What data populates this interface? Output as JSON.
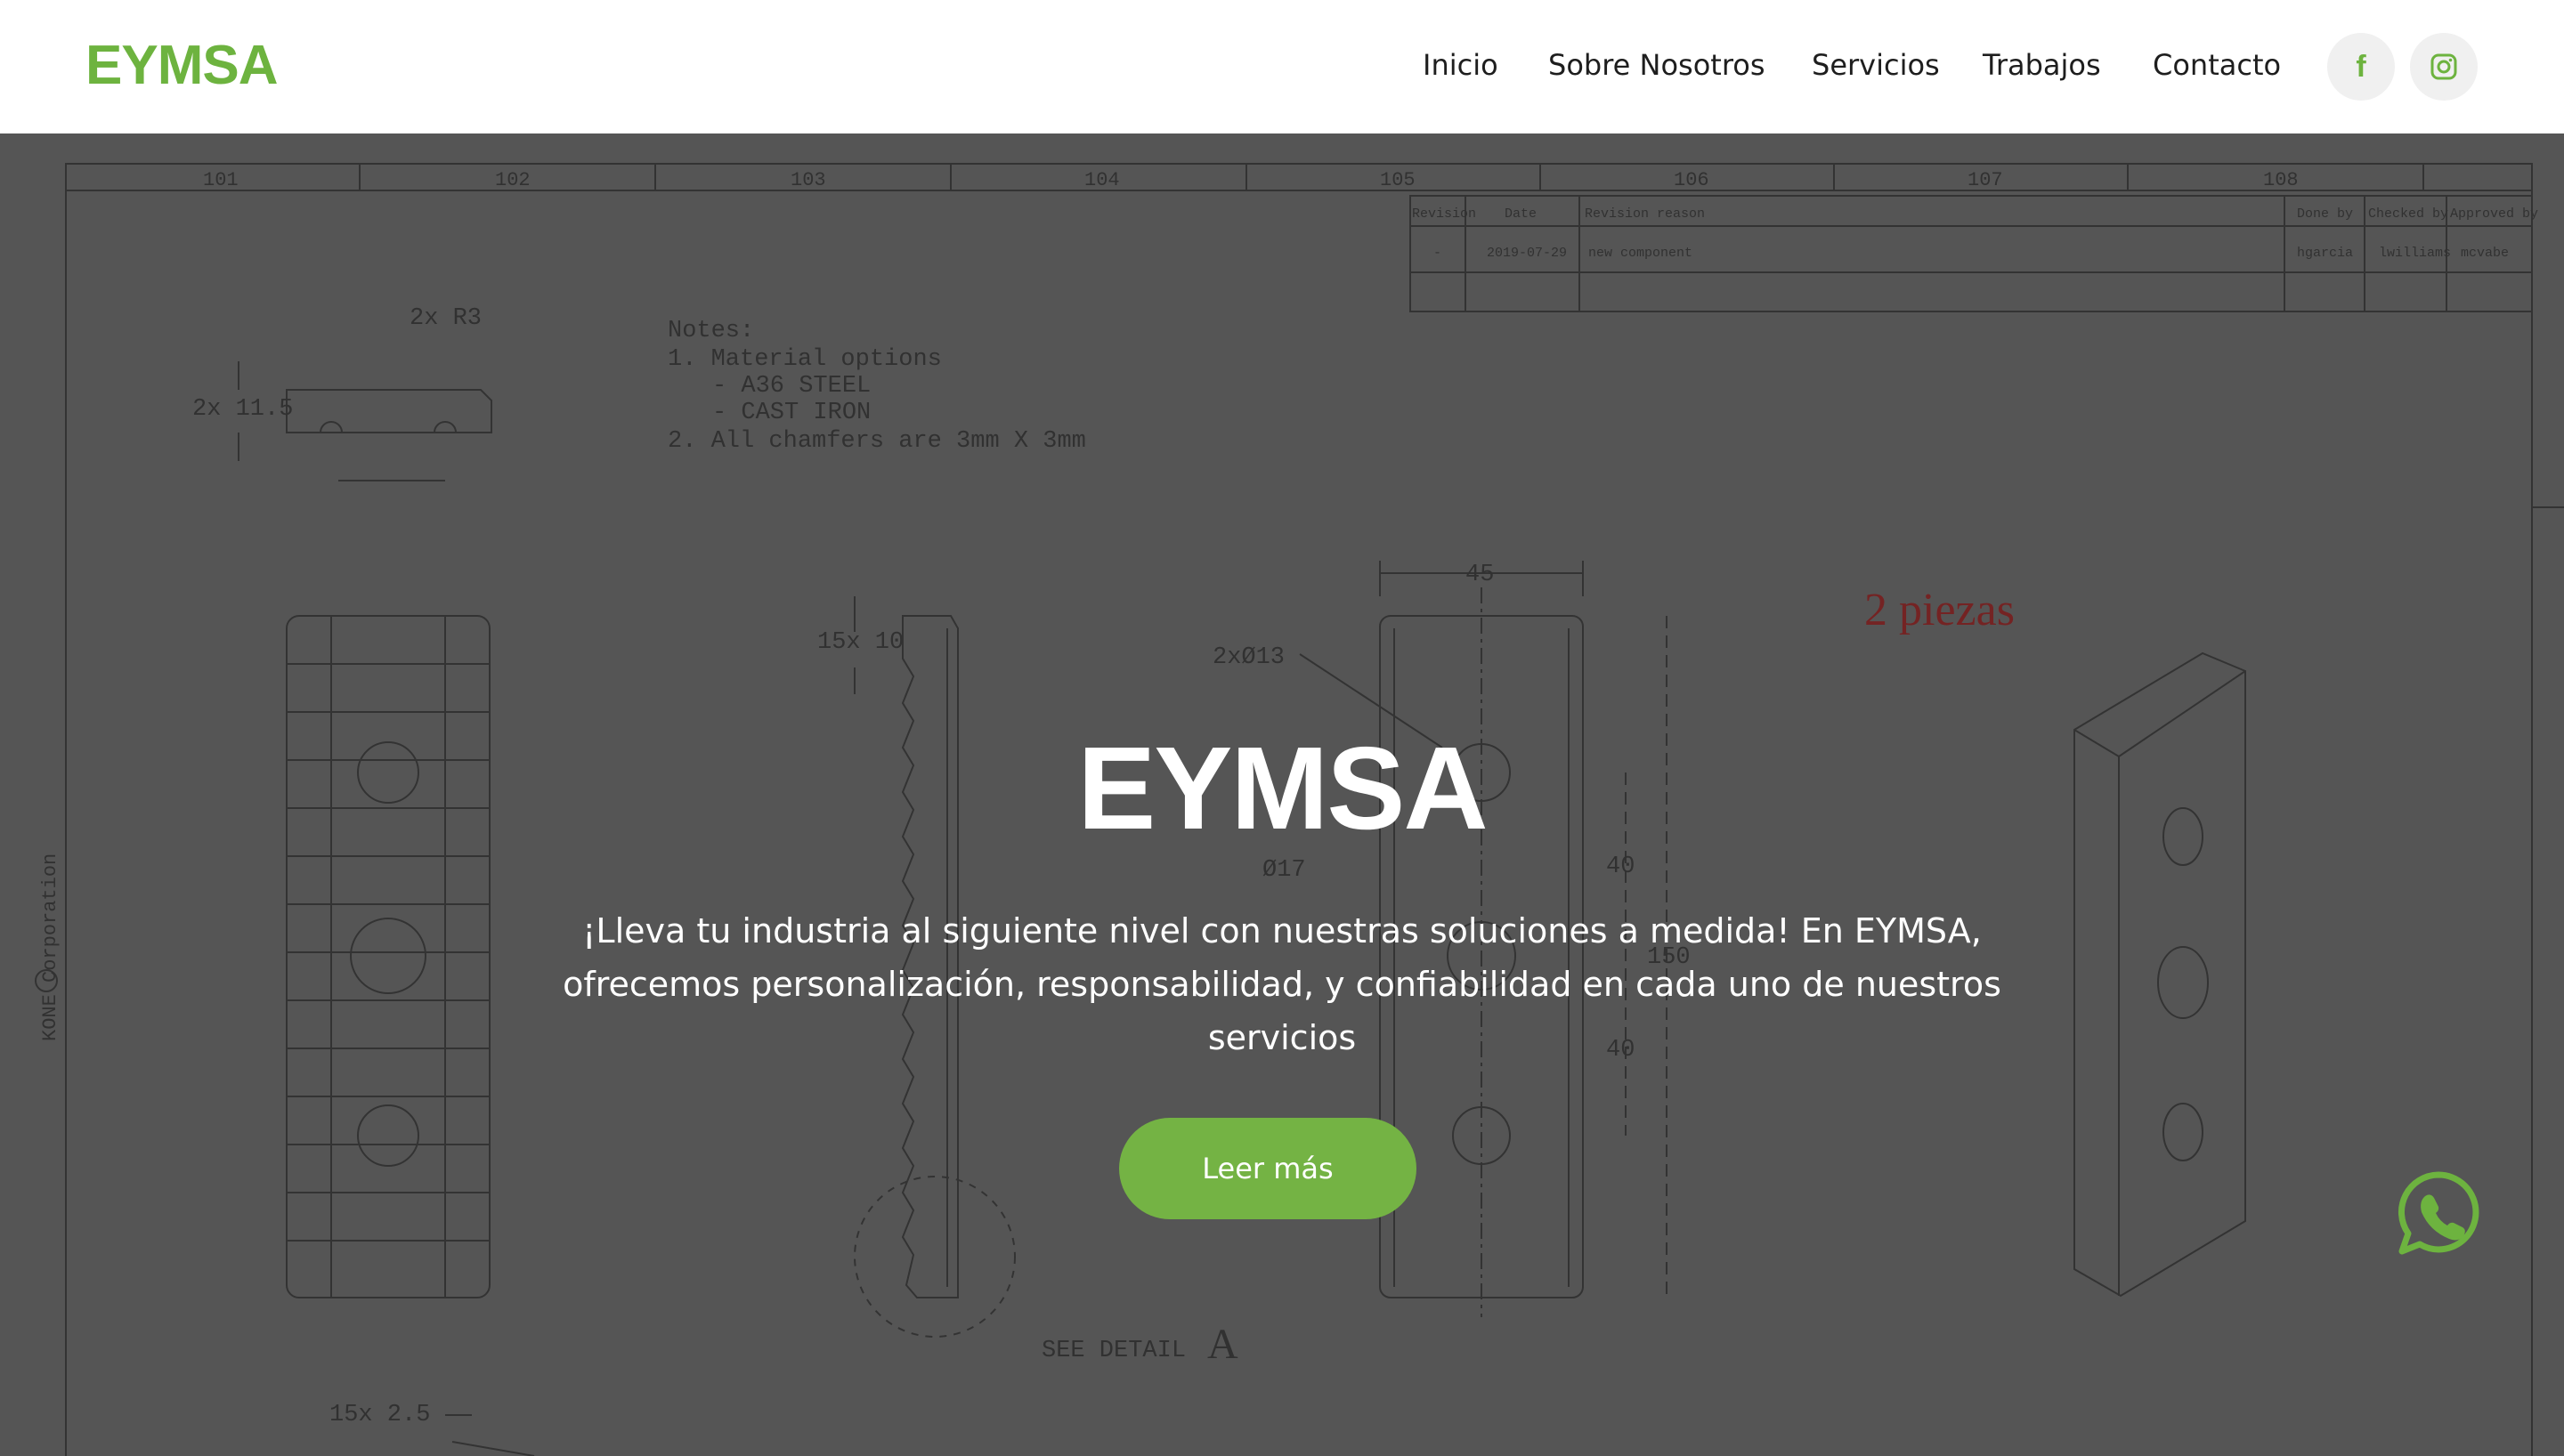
{
  "header": {
    "logo": "EYMSA",
    "nav": [
      "Inicio",
      "Sobre Nosotros",
      "Servicios",
      "Trabajos",
      "Contacto"
    ],
    "social": [
      {
        "icon": "facebook-icon",
        "glyph": "f"
      },
      {
        "icon": "instagram-icon",
        "glyph": ""
      }
    ]
  },
  "hero": {
    "title": "EYMSA",
    "text": "¡Lleva tu industria al siguiente nivel con nuestras soluciones a medida! En EYMSA, ofrecemos personalización, responsabilidad, y confiabilidad en cada uno de nuestros servicios",
    "button": "Leer más",
    "background": {
      "notes": [
        "Notes:",
        "1. Material options",
        "- A36 STEEL",
        "- CAST IRON",
        "2. All chamfers are 3mm X 3mm"
      ],
      "label_pieces": "2 piezas",
      "dims": [
        "2x R3",
        "2x 11.5",
        "15x 10",
        "45",
        "2xØ13",
        "Ø17",
        "40",
        "40",
        "150",
        "15x 2.5",
        "SEE DETAIL",
        "A"
      ],
      "grid_numbers": [
        "101",
        "102",
        "103",
        "104",
        "105",
        "106",
        "107",
        "108"
      ],
      "revision_headers": [
        "Revision",
        "Date",
        "Revision reason",
        "Done by",
        "Checked by",
        "Approved by"
      ],
      "revision_row": [
        "-",
        "2019-07-29",
        "new component",
        "hgarcia",
        "lwilliams",
        "mcvabe"
      ],
      "side_text": "KONE Corporation"
    }
  },
  "colors": {
    "brand": "#6db33f",
    "button": "#74b344",
    "header_bg": "#ffffff",
    "pieces_red": "#b32020"
  },
  "floating": {
    "icon": "whatsapp-icon"
  }
}
